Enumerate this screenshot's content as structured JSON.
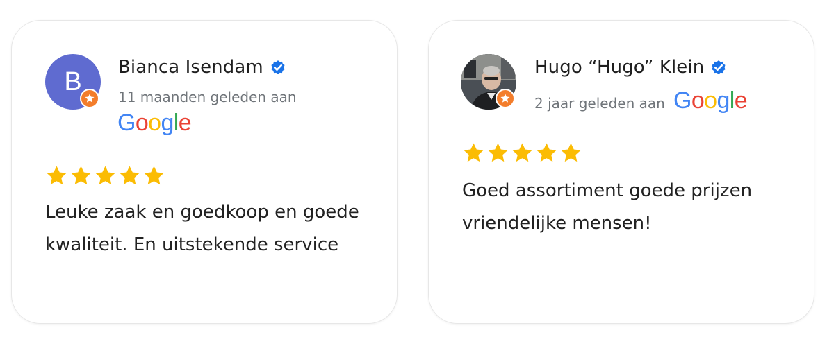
{
  "colors": {
    "avatar_bg": "#5f6bd0",
    "verified_blue": "#1a73e8",
    "local_guide_orange": "#f37d2b",
    "star_gold": "#fbbc04",
    "google_blue": "#4285F4",
    "google_red": "#EA4335",
    "google_yellow": "#FBBC05",
    "google_green": "#34A853"
  },
  "reviews": [
    {
      "avatar_letter": "B",
      "name": "Bianca Isendam",
      "time_text": "11 maanden geleden aan",
      "source_letters": [
        "G",
        "o",
        "o",
        "g",
        "l",
        "e"
      ],
      "rating": 5,
      "text": "Leuke zaak en goedkoop en goede kwaliteit. En uitstekende service"
    },
    {
      "avatar_letter": "",
      "name": "Hugo “Hugo” Klein",
      "time_text": "2 jaar geleden aan",
      "source_letters": [
        "G",
        "o",
        "o",
        "g",
        "l",
        "e"
      ],
      "rating": 5,
      "text": "Goed assortiment goede prijzen vriendelijke mensen!"
    }
  ]
}
